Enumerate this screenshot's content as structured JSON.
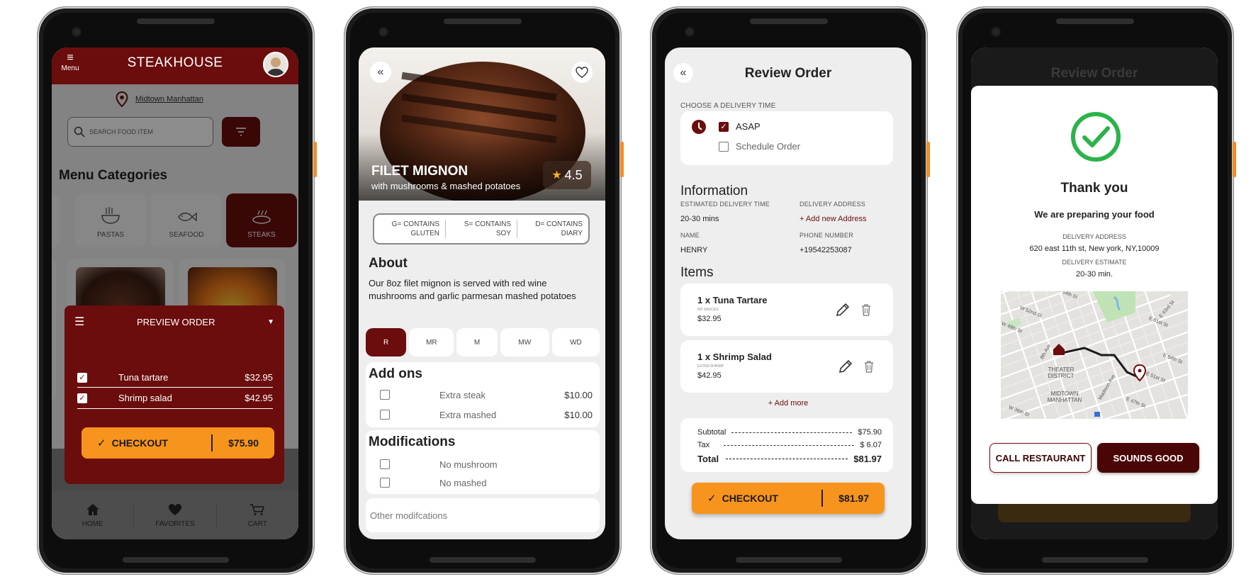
{
  "screen1": {
    "menu_label": "Menu",
    "title": "STEAKHOUSE",
    "location": "Midtown Manhattan",
    "search_placeholder": "SEARCH FOOD ITEM",
    "section_title": "Menu Categories",
    "categories": [
      {
        "label": "PASTAS",
        "icon": "noodle-bowl-icon"
      },
      {
        "label": "SEAFOOD",
        "icon": "fish-icon"
      },
      {
        "label": "STEAKS",
        "icon": "steak-icon"
      }
    ],
    "preview": {
      "title": "PREVIEW ORDER",
      "items": [
        {
          "name": "Tuna tartare",
          "price": "$32.95"
        },
        {
          "name": "Shrimp salad",
          "price": "$42.95"
        }
      ],
      "checkout_label": "CHECKOUT",
      "checkout_total": "$75.90"
    },
    "nav": [
      "HOME",
      "FAVORITES",
      "CART"
    ]
  },
  "screen2": {
    "dish_name": "FILET MIGNON",
    "dish_sub": "with mushrooms & mashed potatoes",
    "rating": "4.5",
    "allergens": [
      {
        "line1": "G= CONTAINS",
        "line2": "GLUTEN"
      },
      {
        "line1": "S= CONTAINS",
        "line2": "SOY"
      },
      {
        "line1": "D= CONTAINS",
        "line2": "DIARY"
      }
    ],
    "about_title": "About",
    "about_text": "Our 8oz filet mignon is served with red wine mushrooms and garlic parmesan mashed potatoes",
    "doneness": [
      "R",
      "MR",
      "M",
      "MW",
      "WD"
    ],
    "doneness_selected": "R",
    "addons_title": "Add ons",
    "addons": [
      {
        "name": "Extra steak",
        "price": "$10.00"
      },
      {
        "name": "Extra mashed",
        "price": "$10.00"
      }
    ],
    "mods_title": "Modifications",
    "mods": [
      "No mushroom",
      "No mashed"
    ],
    "other_placeholder": "Other modifcations"
  },
  "screen3": {
    "title": "Review Order",
    "delivery_time_label": "CHOOSE A DELIVERY TIME",
    "opt_asap": "ASAP",
    "opt_schedule": "Schedule Order",
    "info_title": "Information",
    "est_label": "ESTIMATED DELIVERY TIME",
    "est_value": "20-30 mins",
    "addr_label": "DELIVERY ADDRESS",
    "addr_value": "+ Add new Address",
    "name_label": "NAME",
    "name_value": "HENRY",
    "phone_label": "PHONE NUMBER",
    "phone_value": "+19542253087",
    "items_title": "Items",
    "items": [
      {
        "name": "1 x Tuna Tartare",
        "note": "NO SAUCES",
        "price": "$32.95"
      },
      {
        "name": "1 x Shrimp Salad",
        "note": "EXTRA SHRIMP",
        "price": "$42.95"
      }
    ],
    "add_more": "+ Add more",
    "subtotal_label": "Subtotal",
    "subtotal_value": "$75.90",
    "tax_label": "Tax",
    "tax_value": "$ 6.07",
    "total_label": "Total",
    "total_value": "$81.97",
    "checkout_label": "CHECKOUT",
    "checkout_total": "$81.97"
  },
  "screen4": {
    "bg_title": "Review Order",
    "thanks": "Thank you",
    "preparing": "We are preparing your food",
    "addr_label": "DELIVERY ADDRESS",
    "addr_value": "620 east 11th st, New york, NY,10009",
    "est_label": "DELIVERY ESTIMATE",
    "est_value": "20-30 min.",
    "map_labels": [
      "W 54th St",
      "W 52nd St",
      "W 49th St",
      "8th Ave",
      "THEATER",
      "DISTRICT",
      "MIDTOWN",
      "MANHATTAN",
      "Madison Ave",
      "E 51st St",
      "E 47th St",
      "W 36th St",
      "E 63rd St",
      "E 61st St",
      "E 54th St"
    ],
    "call_label": "CALL RESTAURANT",
    "ok_label": "SOUNDS GOOD"
  },
  "colors": {
    "maroon": "#6b0d0d",
    "orange": "#f7941d",
    "green": "#2bb34a"
  }
}
